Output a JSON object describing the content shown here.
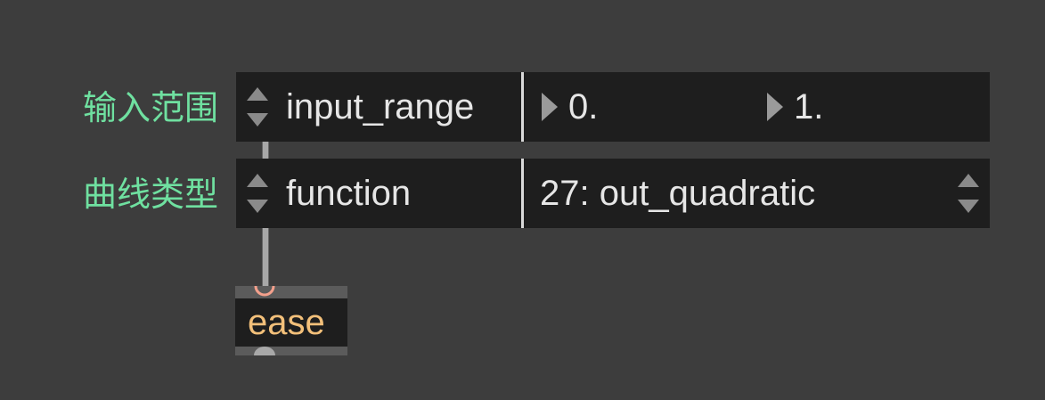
{
  "labels": {
    "input_range": "输入范围",
    "curve_type": "曲线类型"
  },
  "rows": {
    "input_range": {
      "name": "input_range",
      "values": [
        "0.",
        "1."
      ]
    },
    "function": {
      "name": "function",
      "selected": "27: out_quadratic"
    }
  },
  "object": {
    "text": "ease"
  },
  "icons": {
    "stepper": "stepper-arrows-icon",
    "number_arrow": "triangle-right-icon",
    "menu_arrows": "menu-updown-icon",
    "inlet": "inlet-icon",
    "outlet": "outlet-icon"
  },
  "colors": {
    "background": "#3d3d3d",
    "label_green": "#6fe0a0",
    "row_bg": "#1e1e1e",
    "text": "#e6e6e6",
    "object_text": "#f3c07a",
    "inlet": "#f4a08c"
  }
}
